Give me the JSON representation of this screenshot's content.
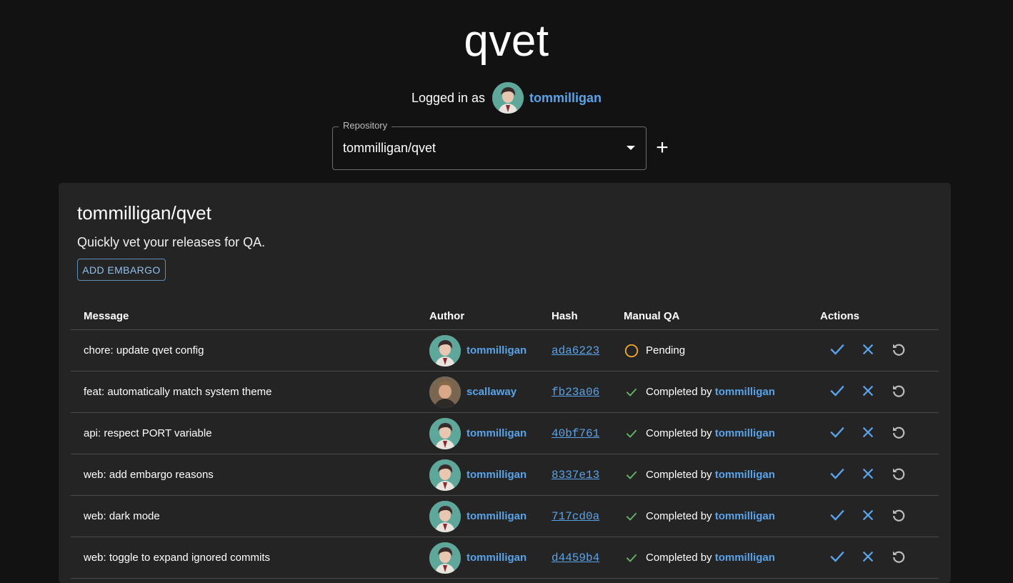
{
  "app": {
    "title": "qvet"
  },
  "login": {
    "label": "Logged in as",
    "username": "tommilligan"
  },
  "repo_select": {
    "label": "Repository",
    "value": "tommilligan/qvet",
    "add_label": "+"
  },
  "card": {
    "title": "tommilligan/qvet",
    "description": "Quickly vet your releases for QA.",
    "embargo_button": "ADD EMBARGO"
  },
  "table": {
    "headers": {
      "message": "Message",
      "author": "Author",
      "hash": "Hash",
      "qa": "Manual QA",
      "actions": "Actions"
    },
    "rows": [
      {
        "message": "chore: update qvet config",
        "author": "tommilligan",
        "avatar": "avatar-tommilligan",
        "hash": "ada6223",
        "qa_status": "pending",
        "qa_text": "Pending",
        "qa_by": ""
      },
      {
        "message": "feat: automatically match system theme",
        "author": "scallaway",
        "avatar": "avatar-scallaway",
        "hash": "fb23a06",
        "qa_status": "completed",
        "qa_text": "Completed by ",
        "qa_by": "tommilligan"
      },
      {
        "message": "api: respect PORT variable",
        "author": "tommilligan",
        "avatar": "avatar-tommilligan",
        "hash": "40bf761",
        "qa_status": "completed",
        "qa_text": "Completed by ",
        "qa_by": "tommilligan"
      },
      {
        "message": "web: add embargo reasons",
        "author": "tommilligan",
        "avatar": "avatar-tommilligan",
        "hash": "8337e13",
        "qa_status": "completed",
        "qa_text": "Completed by ",
        "qa_by": "tommilligan"
      },
      {
        "message": "web: dark mode",
        "author": "tommilligan",
        "avatar": "avatar-tommilligan",
        "hash": "717cd0a",
        "qa_status": "completed",
        "qa_text": "Completed by ",
        "qa_by": "tommilligan"
      },
      {
        "message": "web: toggle to expand ignored commits",
        "author": "tommilligan",
        "avatar": "avatar-tommilligan",
        "hash": "d4459b4",
        "qa_status": "completed",
        "qa_text": "Completed by ",
        "qa_by": "tommilligan"
      }
    ]
  },
  "icons": {
    "approve": "check-icon",
    "reject": "close-icon",
    "reset": "refresh-icon",
    "pending": "circle-outline-icon",
    "completed": "check-small-icon"
  },
  "colors": {
    "link": "#5aa3e8",
    "approve": "#5aa3e8",
    "pending": "#f0a730",
    "completed": "#66bb6a",
    "background": "#121212",
    "card": "#242424"
  }
}
